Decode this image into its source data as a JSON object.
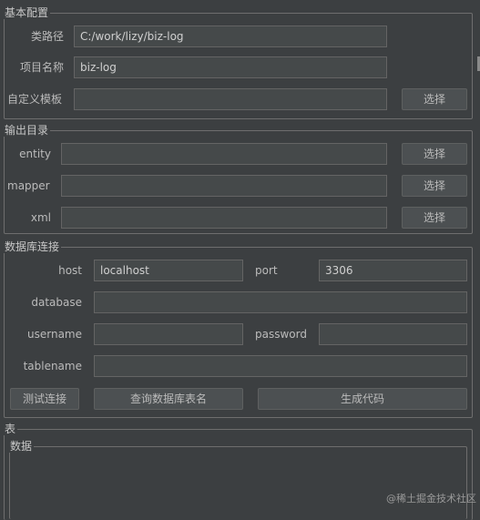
{
  "basic_config": {
    "title": "基本配置",
    "classpath_label": "类路径",
    "classpath_value": "C:/work/lizy/biz-log",
    "project_name_label": "项目名称",
    "project_name_value": "biz-log",
    "custom_template_label": "自定义模板",
    "custom_template_value": "",
    "select_label": "选择"
  },
  "output_dir": {
    "title": "输出目录",
    "entity_label": "entity",
    "entity_value": "",
    "mapper_label": "mapper",
    "mapper_value": "",
    "xml_label": "xml",
    "xml_value": "",
    "select_label": "选择"
  },
  "db": {
    "title": "数据库连接",
    "host_label": "host",
    "host_value": "localhost",
    "port_label": "port",
    "port_value": "3306",
    "database_label": "database",
    "database_value": "",
    "username_label": "username",
    "username_value": "",
    "password_label": "password",
    "password_value": "",
    "tablename_label": "tablename",
    "tablename_value": "",
    "test_button": "测试连接",
    "query_button": "查询数据库表名",
    "generate_button": "生成代码"
  },
  "table": {
    "title": "表",
    "data_title": "数据"
  },
  "watermark": "@稀土掘金技术社区"
}
